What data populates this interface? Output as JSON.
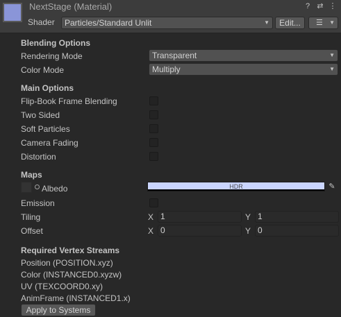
{
  "header": {
    "title": "NextStage (Material)",
    "shader_label": "Shader",
    "shader_value": "Particles/Standard Unlit",
    "edit_button": "Edit...",
    "icons": [
      "help-icon",
      "settings-sliders-icon",
      "more-icon",
      "list-icon"
    ],
    "preview_color": "#8a95d8"
  },
  "blending": {
    "title": "Blending Options",
    "rendering_mode_label": "Rendering Mode",
    "rendering_mode_value": "Transparent",
    "color_mode_label": "Color Mode",
    "color_mode_value": "Multiply"
  },
  "main_options": {
    "title": "Main Options",
    "flipbook_label": "Flip-Book Frame Blending",
    "two_sided_label": "Two Sided",
    "soft_particles_label": "Soft Particles",
    "camera_fading_label": "Camera Fading",
    "distortion_label": "Distortion"
  },
  "maps": {
    "title": "Maps",
    "albedo_label": "Albedo",
    "albedo_color": "#cad5ff",
    "hdr_label": "HDR",
    "emission_label": "Emission",
    "tiling_label": "Tiling",
    "tiling_x": "1",
    "tiling_y": "1",
    "offset_label": "Offset",
    "offset_x": "0",
    "offset_y": "0",
    "x_label": "X",
    "y_label": "Y"
  },
  "streams": {
    "title": "Required Vertex Streams",
    "items": [
      "Position (POSITION.xyz)",
      "Color (INSTANCED0.xyzw)",
      "UV (TEXCOORD0.xy)",
      "AnimFrame (INSTANCED1.x)"
    ],
    "apply_button": "Apply to Systems"
  }
}
